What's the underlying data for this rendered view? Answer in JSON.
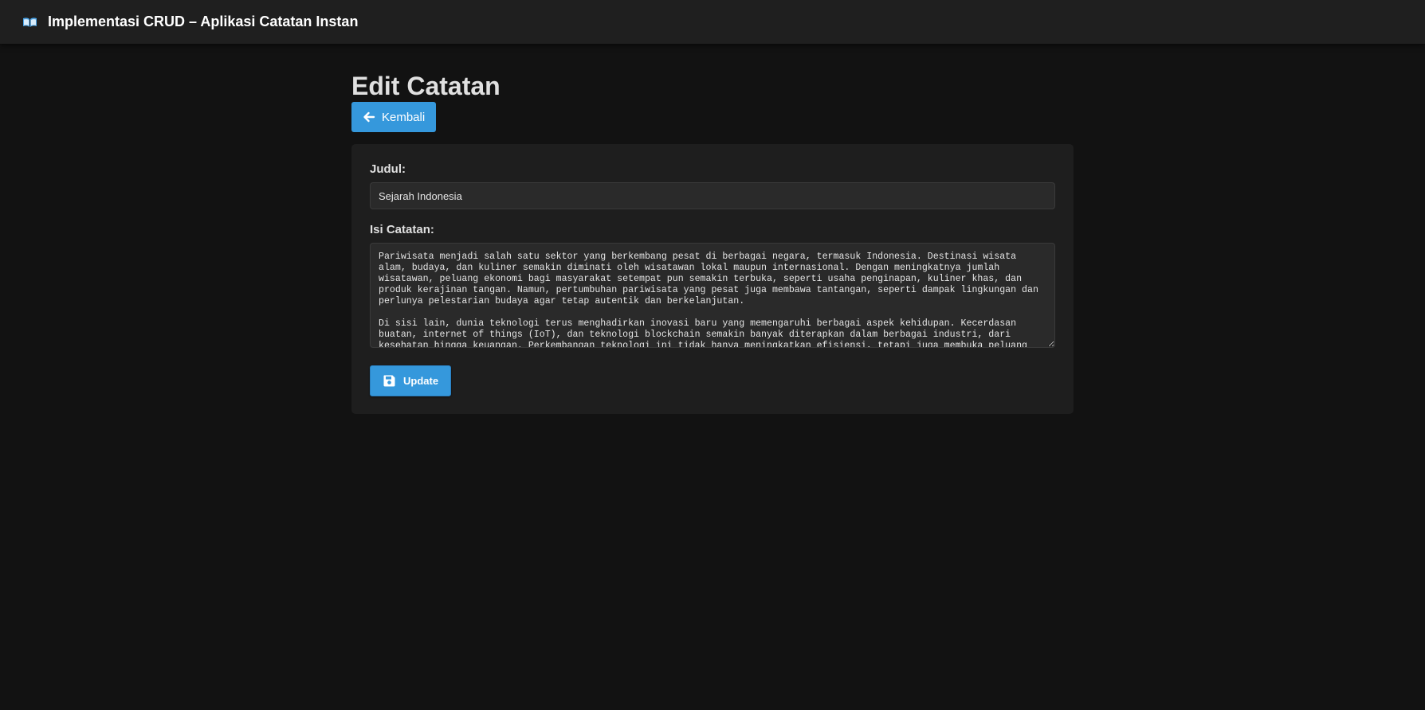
{
  "header": {
    "title": "Implementasi CRUD – Aplikasi Catatan Instan",
    "icon": "book-icon"
  },
  "page": {
    "title": "Edit Catatan",
    "back_label": "Kembali",
    "back_icon": "arrow-left-icon"
  },
  "form": {
    "title_label": "Judul:",
    "title_value": "Sejarah Indonesia",
    "content_label": "Isi Catatan:",
    "content_value": "Pariwisata menjadi salah satu sektor yang berkembang pesat di berbagai negara, termasuk Indonesia. Destinasi wisata alam, budaya, dan kuliner semakin diminati oleh wisatawan lokal maupun internasional. Dengan meningkatnya jumlah wisatawan, peluang ekonomi bagi masyarakat setempat pun semakin terbuka, seperti usaha penginapan, kuliner khas, dan produk kerajinan tangan. Namun, pertumbuhan pariwisata yang pesat juga membawa tantangan, seperti dampak lingkungan dan perlunya pelestarian budaya agar tetap autentik dan berkelanjutan.\n\nDi sisi lain, dunia teknologi terus menghadirkan inovasi baru yang memengaruhi berbagai aspek kehidupan. Kecerdasan buatan, internet of things (IoT), dan teknologi blockchain semakin banyak diterapkan dalam berbagai industri, dari kesehatan hingga keuangan. Perkembangan teknologi ini tidak hanya meningkatkan efisiensi, tetapi juga membuka peluang baru",
    "update_label": "Update",
    "update_icon": "save-icon"
  },
  "colors": {
    "accent": "#3598dc",
    "background": "#121212",
    "card": "#1e1e1e",
    "topbar": "#1f1f1f"
  }
}
